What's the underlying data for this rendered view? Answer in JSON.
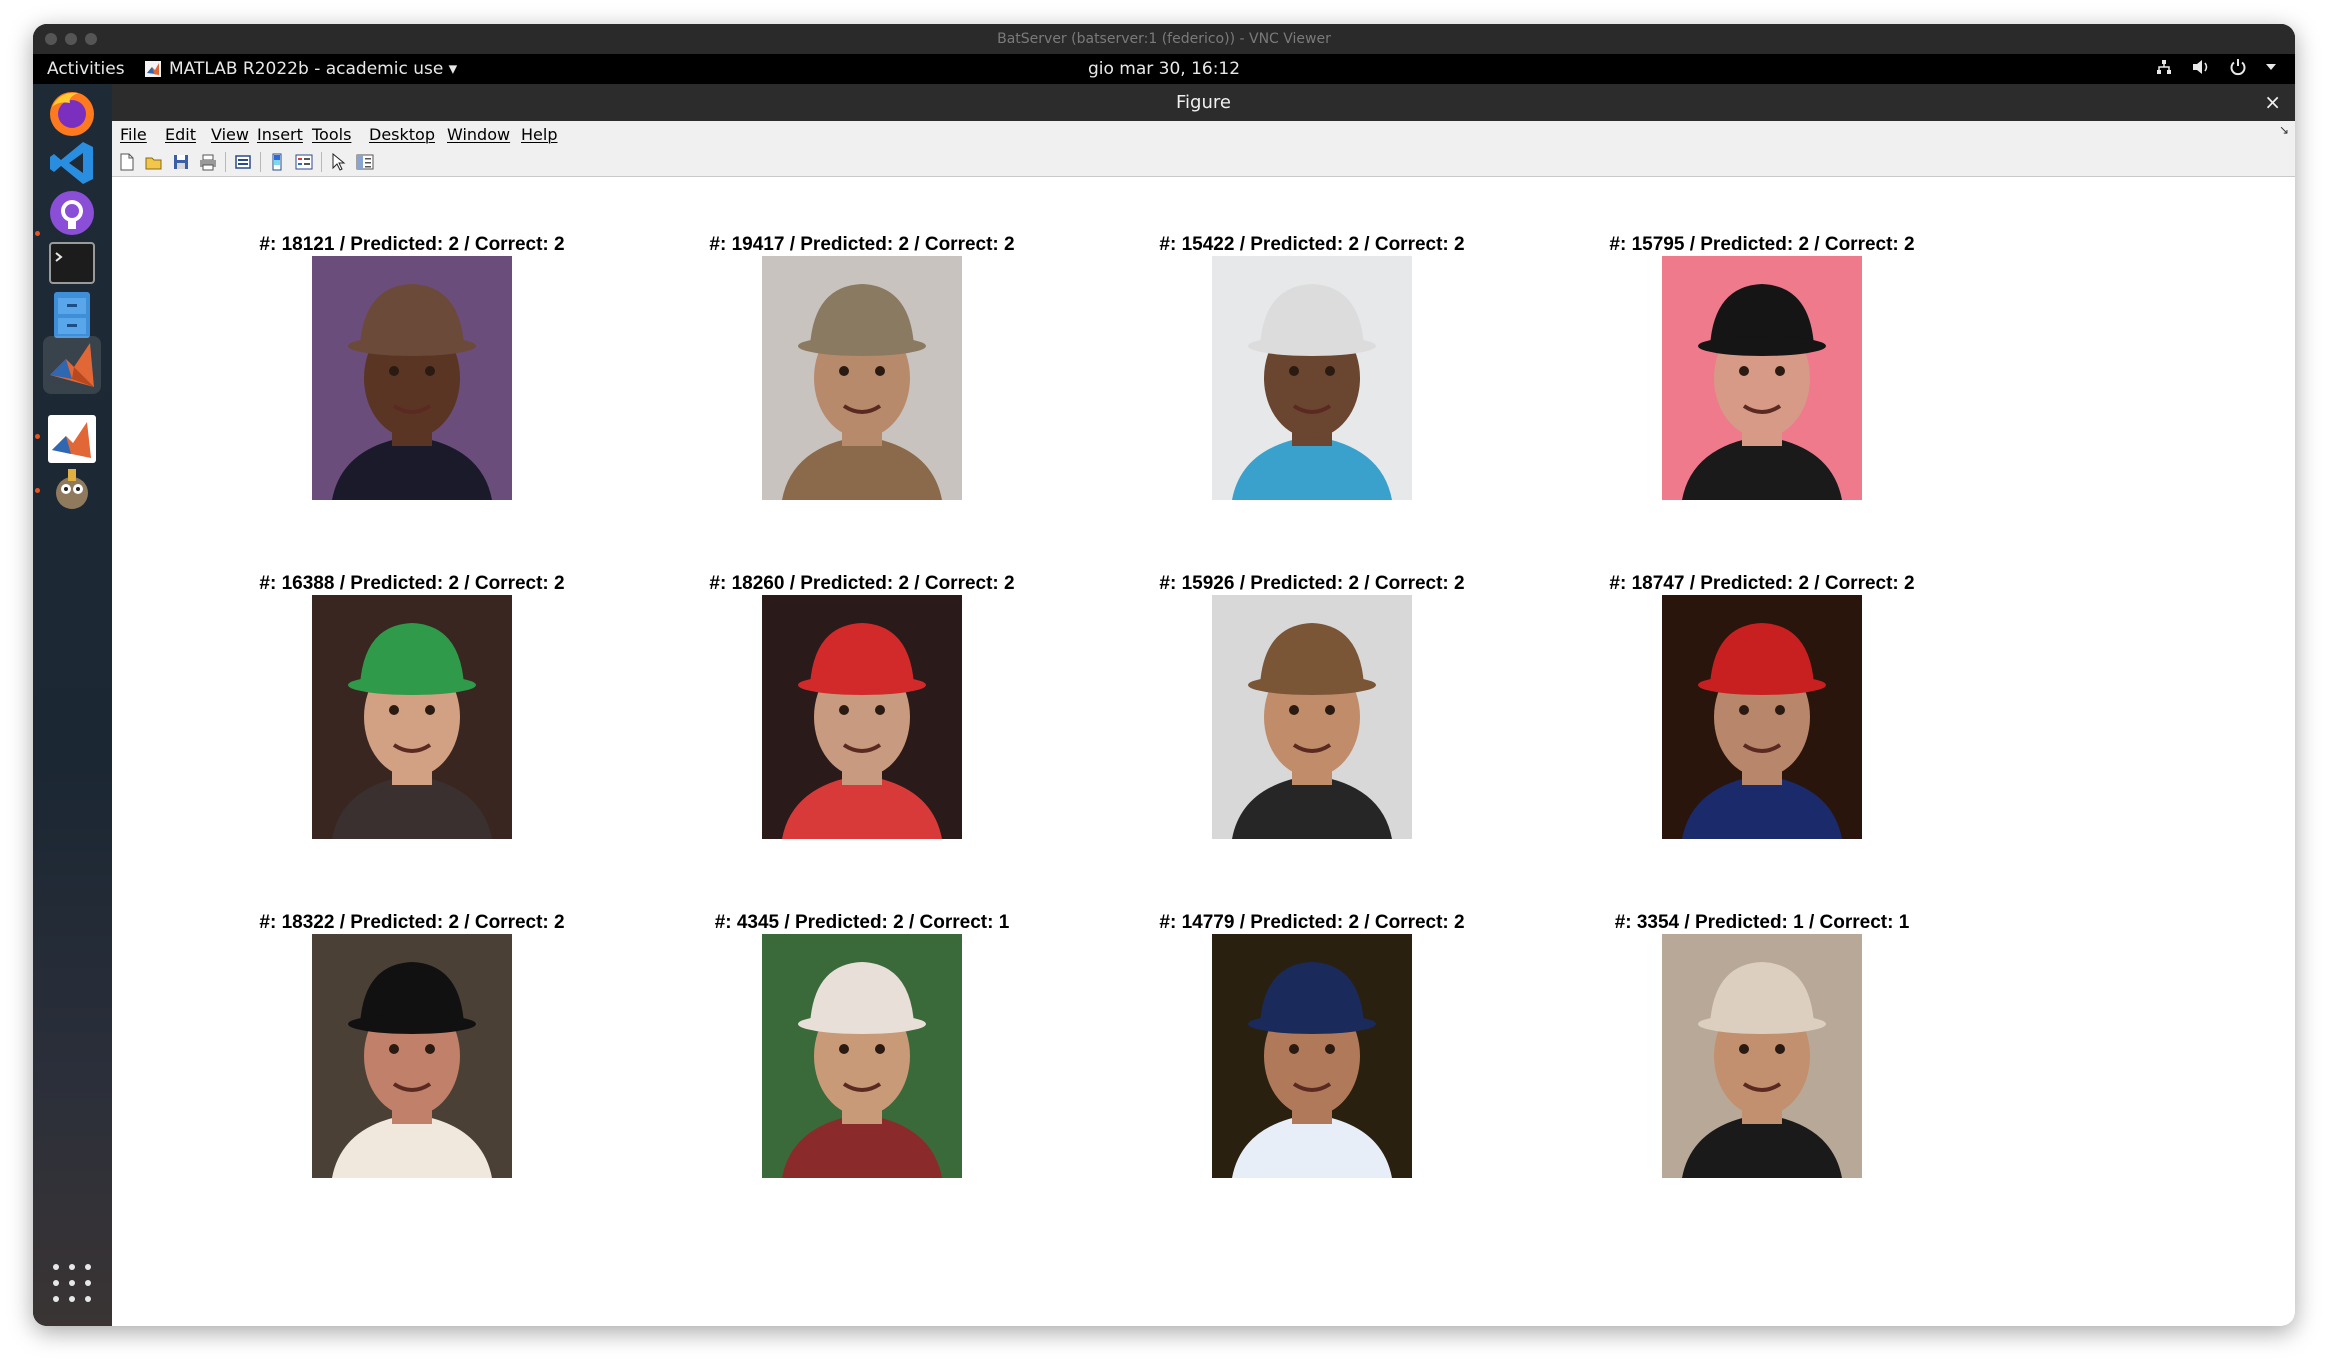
{
  "vnc": {
    "title": "BatServer (batserver:1 (federico)) - VNC Viewer"
  },
  "topbar": {
    "activities": "Activities",
    "app_menu": "MATLAB R2022b - academic use ▾",
    "clock": "gio mar 30, 16:12"
  },
  "dock": {
    "items": [
      "firefox-icon",
      "vscode-icon",
      "github-desktop-icon",
      "terminal-icon",
      "file-cabinet-icon",
      "matlab-icon",
      "matlab-icon",
      "gimp-icon"
    ]
  },
  "figure": {
    "title": "Figure",
    "close": "×",
    "menu": [
      "File",
      "Edit",
      "View",
      "Insert",
      "Tools",
      "Desktop",
      "Window",
      "Help"
    ]
  },
  "results": [
    {
      "title": "#: 18121 / Predicted: 2 / Correct: 2",
      "bg": "#6a4d7a",
      "skin": "#5a3524",
      "hat": "#6b4a3a",
      "shirt": "#1a1a2a"
    },
    {
      "title": "#: 19417 / Predicted: 2 / Correct: 2",
      "bg": "#c9c3bf",
      "skin": "#b88a6c",
      "hat": "#8a7a62",
      "shirt": "#8a6a4a"
    },
    {
      "title": "#: 15422 / Predicted: 2 / Correct: 2",
      "bg": "#e6e8ea",
      "skin": "#6a4530",
      "hat": "#dcdcdc",
      "shirt": "#3aa0cc"
    },
    {
      "title": "#: 15795 / Predicted: 2 / Correct: 2",
      "bg": "#ee7a8c",
      "skin": "#d79a86",
      "hat": "#151515",
      "shirt": "#1a1a1a"
    },
    {
      "title": "#: 16388 / Predicted: 2 / Correct: 2",
      "bg": "#3a2620",
      "skin": "#d2a184",
      "hat": "#2e9a4a",
      "shirt": "#3a3030"
    },
    {
      "title": "#: 18260 / Predicted: 2 / Correct: 2",
      "bg": "#2a1a1a",
      "skin": "#c89a80",
      "hat": "#d22a2a",
      "shirt": "#d83a3a"
    },
    {
      "title": "#: 15926 / Predicted: 2 / Correct: 2",
      "bg": "#d8d8d8",
      "skin": "#c08c6a",
      "hat": "#7a5536",
      "shirt": "#262626"
    },
    {
      "title": "#: 18747 / Predicted: 2 / Correct: 2",
      "bg": "#2a150d",
      "skin": "#b8866a",
      "hat": "#c82020",
      "shirt": "#1a2a6a"
    },
    {
      "title": "#: 18322 / Predicted: 2 / Correct: 2",
      "bg": "#4a4036",
      "skin": "#c0806a",
      "hat": "#111111",
      "shirt": "#f0e8dc"
    },
    {
      "title": "#: 4345 / Predicted: 2 / Correct: 1",
      "bg": "#3a6a3a",
      "skin": "#c99a78",
      "hat": "#e8e0d8",
      "shirt": "#8a2a2a"
    },
    {
      "title": "#: 14779 / Predicted: 2 / Correct: 2",
      "bg": "#2a2010",
      "skin": "#b07a5a",
      "hat": "#1a2a5a",
      "shirt": "#e8eef8"
    },
    {
      "title": "#: 3354 / Predicted: 1 / Correct: 1",
      "bg": "#b8a898",
      "skin": "#c2906e",
      "hat": "#dccfc0",
      "shirt": "#1a1a1a"
    }
  ]
}
